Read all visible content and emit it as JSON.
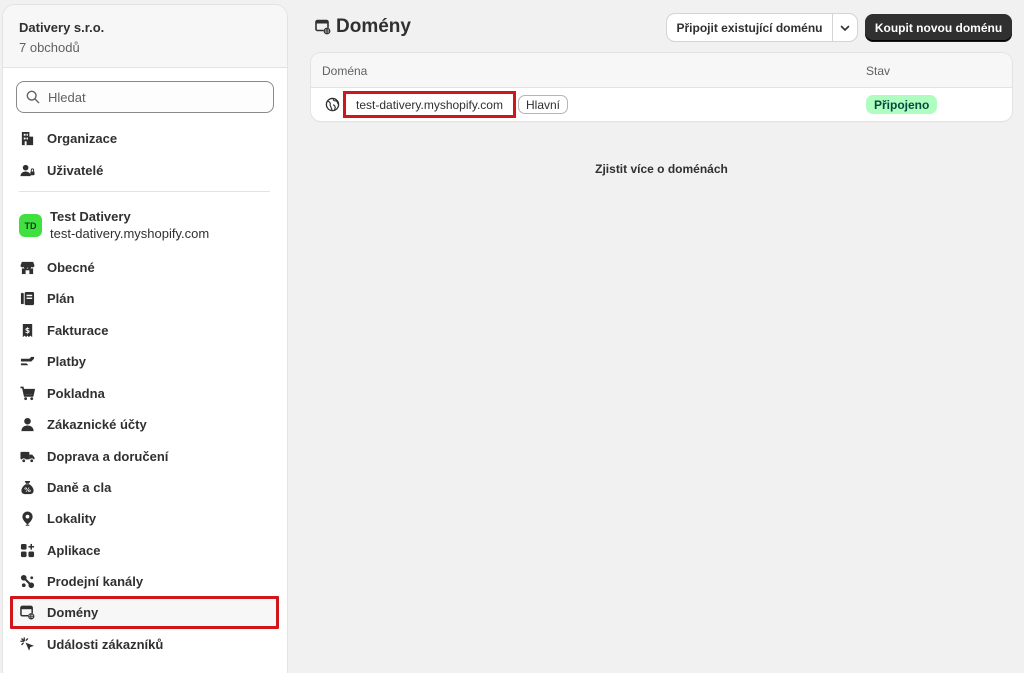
{
  "sidebar": {
    "org_name": "Dativery s.r.o.",
    "org_count": "7 obchodů",
    "search_placeholder": "Hledat",
    "top_items": [
      {
        "label": "Organizace",
        "icon": "building-icon"
      },
      {
        "label": "Uživatelé",
        "icon": "users-icon"
      }
    ],
    "store": {
      "avatar": "TD",
      "avatar_color": "#3fe03f",
      "name": "Test Dativery",
      "url": "test-dativery.myshopify.com"
    },
    "items": [
      {
        "label": "Obecné",
        "icon": "store-icon"
      },
      {
        "label": "Plán",
        "icon": "plan-icon"
      },
      {
        "label": "Fakturace",
        "icon": "receipt-icon"
      },
      {
        "label": "Platby",
        "icon": "payments-icon"
      },
      {
        "label": "Pokladna",
        "icon": "cart-icon"
      },
      {
        "label": "Zákaznické účty",
        "icon": "person-icon"
      },
      {
        "label": "Doprava a doručení",
        "icon": "truck-icon"
      },
      {
        "label": "Daně a cla",
        "icon": "tax-icon"
      },
      {
        "label": "Lokality",
        "icon": "location-icon"
      },
      {
        "label": "Aplikace",
        "icon": "apps-icon"
      },
      {
        "label": "Prodejní kanály",
        "icon": "channels-icon"
      },
      {
        "label": "Domény",
        "icon": "domain-icon",
        "active": true
      },
      {
        "label": "Události zákazníků",
        "icon": "cursor-icon"
      }
    ]
  },
  "header": {
    "title": "Domény",
    "connect_label": "Připojit existující doménu",
    "buy_label": "Koupit novou doménu"
  },
  "table": {
    "columns": [
      "Doména",
      "Stav"
    ],
    "rows": [
      {
        "domain": "test-dativery.myshopify.com",
        "badge": "Hlavní",
        "status": "Připojeno",
        "status_color": "#affebf"
      }
    ]
  },
  "footer": {
    "learn_more": "Zjistit více o doménách"
  },
  "colors": {
    "accent": "#303030",
    "highlight": "#d2141b"
  }
}
